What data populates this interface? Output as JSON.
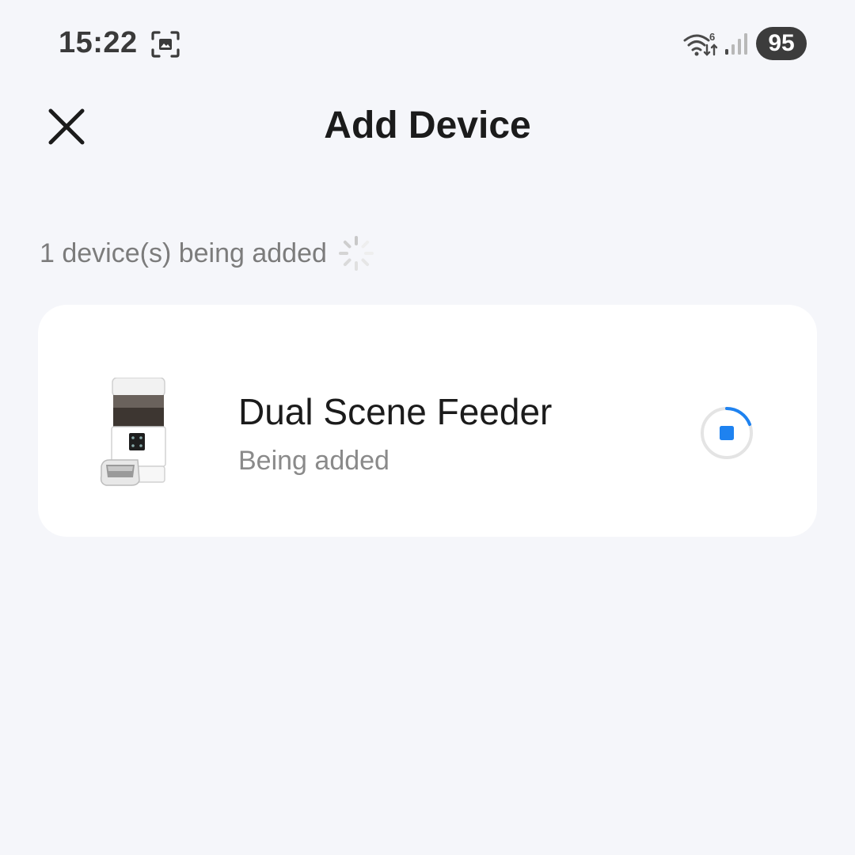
{
  "status_bar": {
    "time": "15:22",
    "battery": "95",
    "icons": [
      "screenshot-icon",
      "wifi-6-icon",
      "signal-icon"
    ]
  },
  "header": {
    "title": "Add Device",
    "close_icon": "close-icon"
  },
  "progress": {
    "text": "1 device(s) being added",
    "spinner_icon": "loading-spinner-icon"
  },
  "device": {
    "name": "Dual Scene Feeder",
    "status": "Being added",
    "image": "pet-feeder-image",
    "action_icon": "stop-progress-icon"
  },
  "colors": {
    "background": "#f5f6fa",
    "card": "#ffffff",
    "accent": "#1e82f0",
    "secondary_text": "#8a8a8a"
  }
}
